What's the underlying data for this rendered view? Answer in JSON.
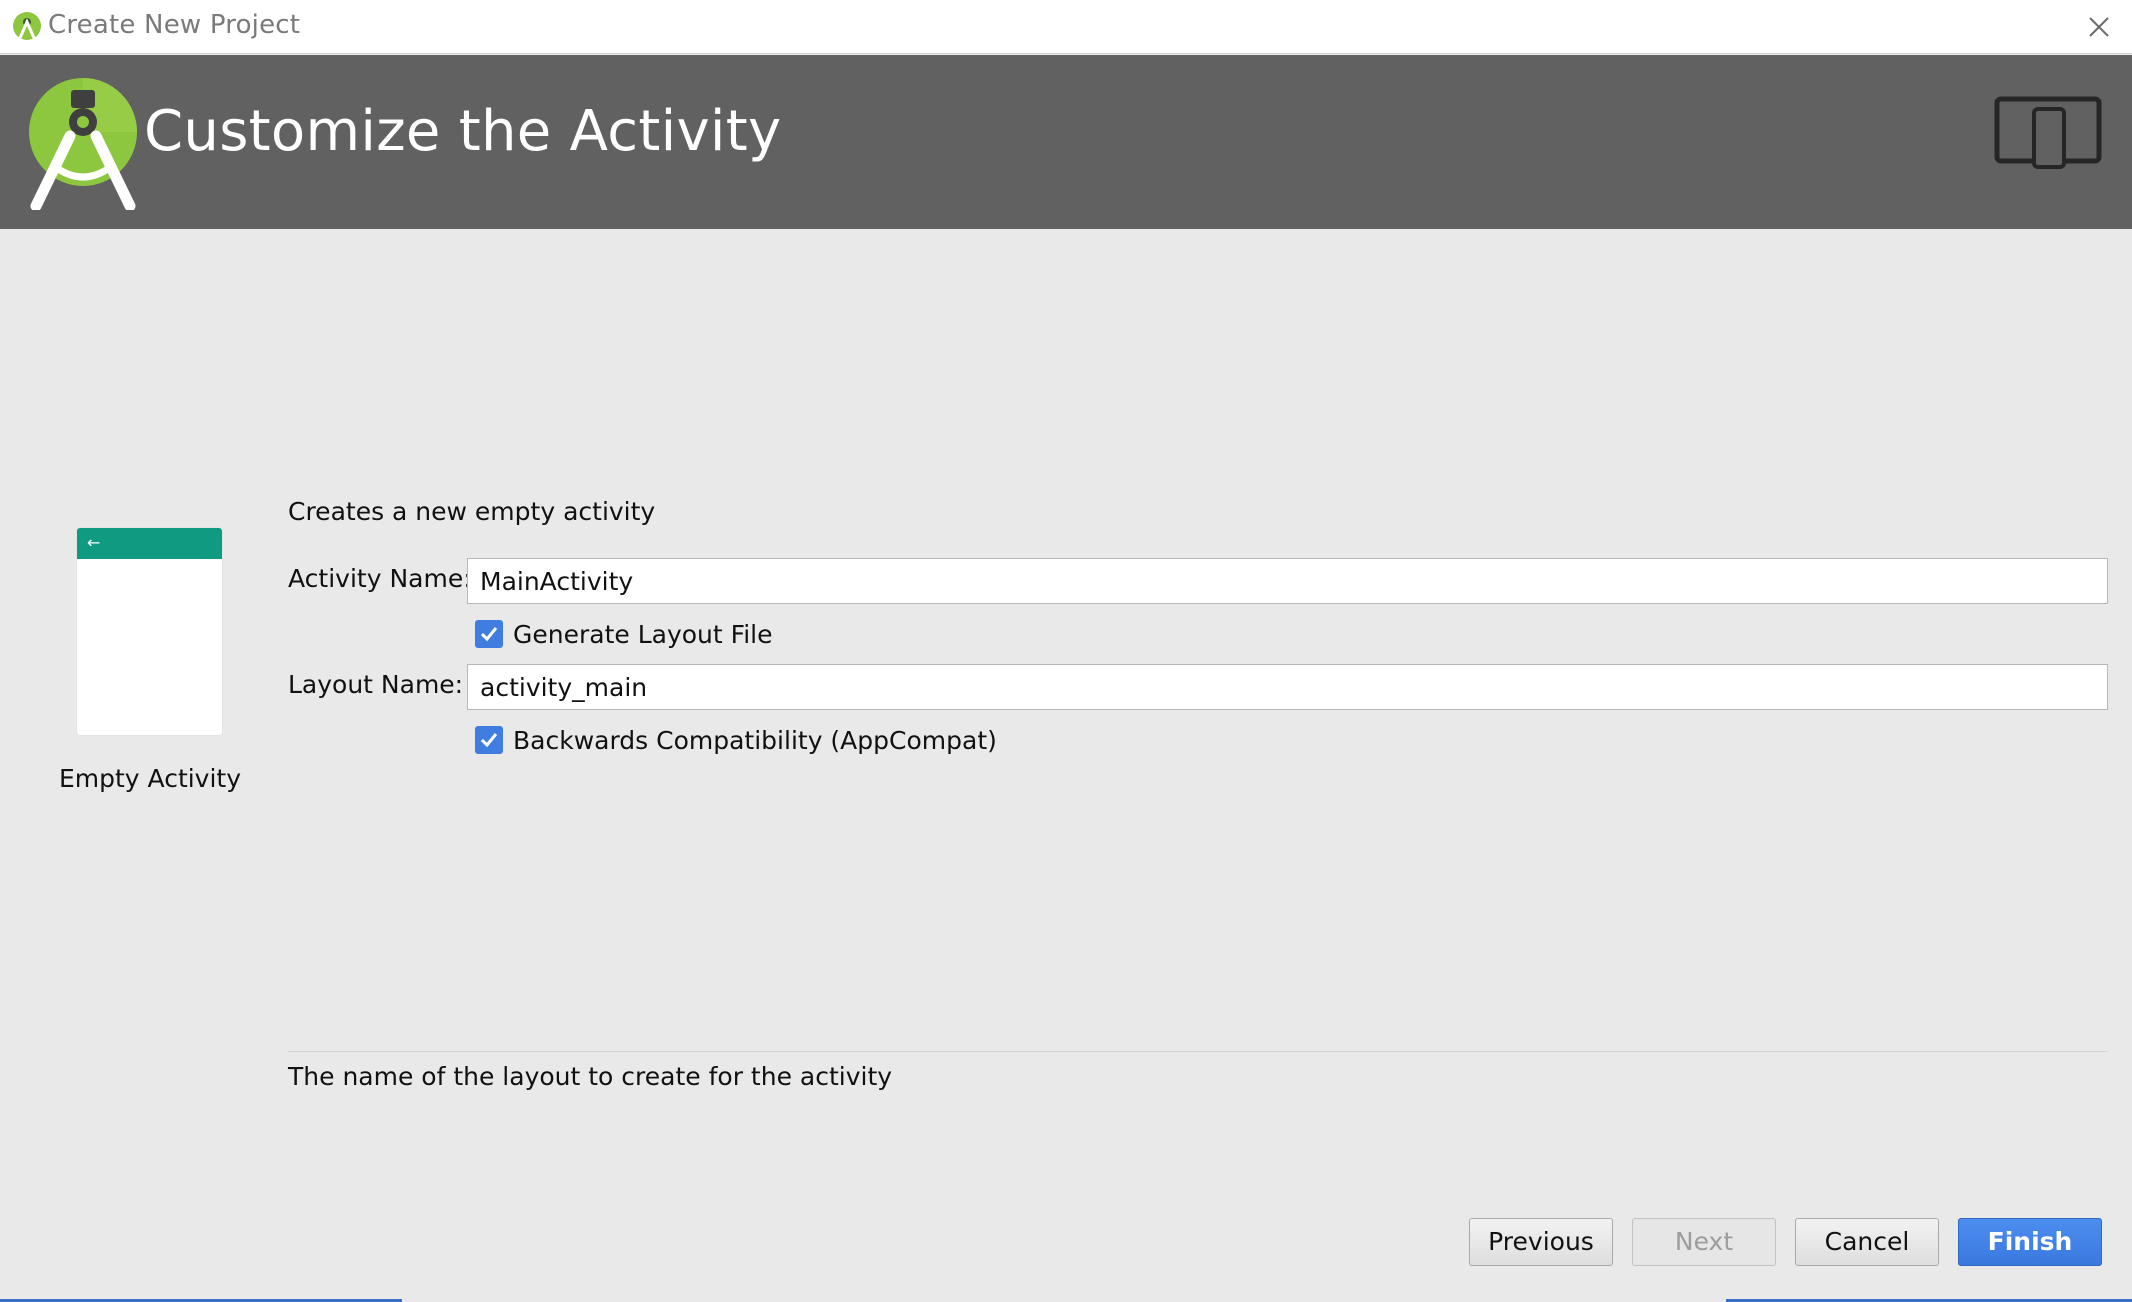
{
  "window": {
    "title": "Create New Project"
  },
  "header": {
    "title": "Customize the Activity"
  },
  "template": {
    "description": "Creates a new empty activity",
    "caption": "Empty Activity",
    "preview_arrow": "←"
  },
  "form": {
    "activity_name_label": "Activity Name:",
    "activity_name_value": "MainActivity",
    "generate_layout_label": "Generate Layout File",
    "generate_layout_checked": true,
    "layout_name_label": "Layout Name:",
    "layout_name_value": "activity_main",
    "backwards_compat_label": "Backwards Compatibility (AppCompat)",
    "backwards_compat_checked": true
  },
  "help": {
    "text": "The name of the layout to create for the activity"
  },
  "buttons": {
    "previous": "Previous",
    "next": "Next",
    "cancel": "Cancel",
    "finish": "Finish"
  },
  "colors": {
    "header_bg": "#616161",
    "accent_blue": "#3f7ee0",
    "preview_toolbar": "#0f9a82",
    "android_green": "#8dc63f"
  },
  "icons": {
    "app": "android-studio-icon",
    "close": "close-icon",
    "logo": "android-studio-logo",
    "device": "phone-tablet-icon",
    "check": "checkmark-icon"
  }
}
